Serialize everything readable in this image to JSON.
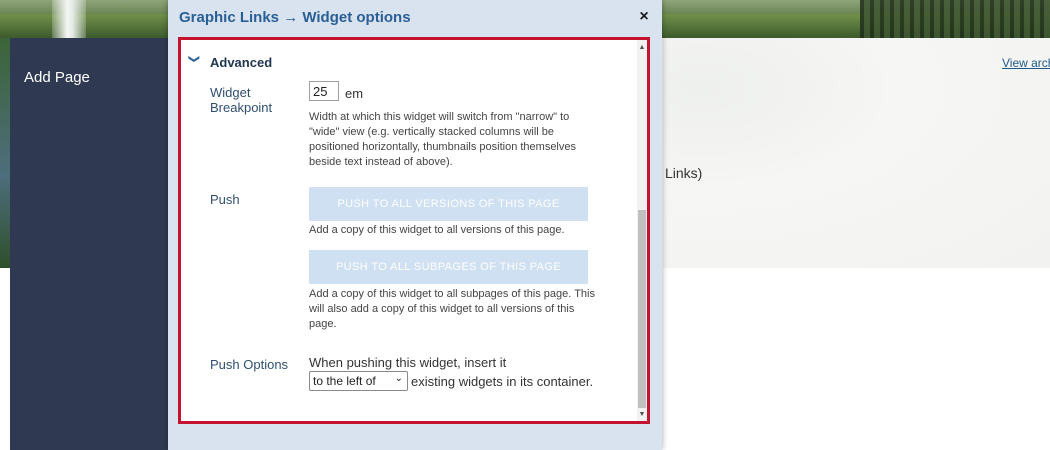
{
  "background": {
    "sidebar": {
      "add_page": "Add Page"
    },
    "view_archive": "View arch",
    "links_fragment": "Links)"
  },
  "dialog": {
    "title": "Graphic Links → Widget options",
    "close_icon": "×",
    "section": {
      "title": "Advanced",
      "expanded": true
    },
    "breakpoint": {
      "label": "Widget Breakpoint",
      "value": "25",
      "unit": "em",
      "help": "Width at which this widget will switch from \"narrow\" to \"wide\" view (e.g. vertically stacked columns will be positioned horizontally, thumbnails position themselves beside text instead of above)."
    },
    "push": {
      "label": "Push",
      "all_versions_button": "PUSH TO ALL VERSIONS OF THIS PAGE",
      "all_versions_help": "Add a copy of this widget to all versions of this page.",
      "all_subpages_button": "PUSH TO ALL SUBPAGES OF THIS PAGE",
      "all_subpages_help": "Add a copy of this widget to all subpages of this page. This will also add a copy of this widget to all versions of this page."
    },
    "push_options": {
      "label": "Push Options",
      "intro": "When pushing this widget, insert it",
      "selected": "to the left of",
      "suffix": "existing widgets in its container."
    }
  },
  "colors": {
    "dialog_bg": "#d8e3ef",
    "title": "#2a5f95",
    "highlight_border": "#c4122f",
    "sidebar": "#2f3a52",
    "push_button_bg": "#cfe0f2"
  }
}
